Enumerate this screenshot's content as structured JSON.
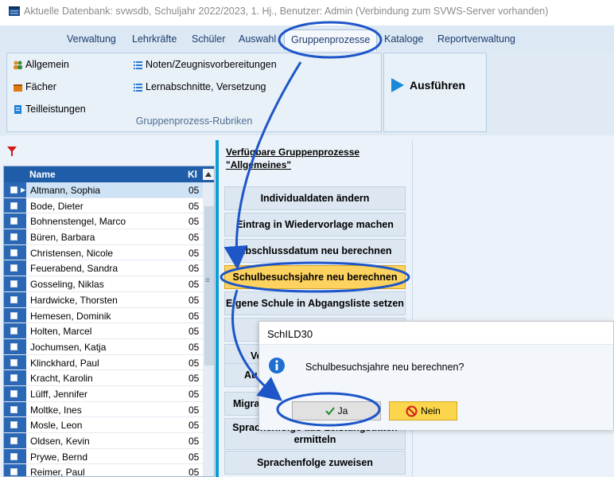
{
  "window": {
    "title": "Aktuelle Datenbank: svwsdb, Schuljahr 2022/2023, 1. Hj., Benutzer: Admin (Verbindung zum SVWS-Server vorhanden)"
  },
  "menu": {
    "tabs": [
      {
        "label": "Verwaltung"
      },
      {
        "label": "Lehrkräfte"
      },
      {
        "label": "Schüler"
      },
      {
        "label": "Auswahl"
      },
      {
        "label": "Gruppenprozesse"
      },
      {
        "label": "Kataloge"
      },
      {
        "label": "Reportverwaltung"
      }
    ],
    "active": "Gruppenprozesse"
  },
  "ribbon": {
    "items": [
      {
        "label": "Allgemein",
        "icon": "people-icon"
      },
      {
        "label": "Fächer",
        "icon": "books-icon"
      },
      {
        "label": "Teilleistungen",
        "icon": "document-icon"
      },
      {
        "label": "Noten/Zeugnisvorbereitungen",
        "icon": "list-icon"
      },
      {
        "label": "Lernabschnitte, Versetzung",
        "icon": "list-icon"
      }
    ],
    "group_label": "Gruppenprozess-Rubriken",
    "run_label": "Ausführen"
  },
  "grid": {
    "columns": [
      "Name",
      "Kl"
    ],
    "rows": [
      {
        "name": "Altmann, Sophia",
        "kl": "05"
      },
      {
        "name": "Bode, Dieter",
        "kl": "05"
      },
      {
        "name": "Bohnenstengel, Marco",
        "kl": "05"
      },
      {
        "name": "Büren, Barbara",
        "kl": "05"
      },
      {
        "name": "Christensen, Nicole",
        "kl": "05"
      },
      {
        "name": "Feuerabend, Sandra",
        "kl": "05"
      },
      {
        "name": "Gosseling, Niklas",
        "kl": "05"
      },
      {
        "name": "Hardwicke, Thorsten",
        "kl": "05"
      },
      {
        "name": "Hemesen, Dominik",
        "kl": "05"
      },
      {
        "name": "Holten, Marcel",
        "kl": "05"
      },
      {
        "name": "Jochumsen, Katja",
        "kl": "05"
      },
      {
        "name": "Klinckhard, Paul",
        "kl": "05"
      },
      {
        "name": "Kracht, Karolin",
        "kl": "05"
      },
      {
        "name": "Lülff, Jennifer",
        "kl": "05"
      },
      {
        "name": "Moltke, Ines",
        "kl": "05"
      },
      {
        "name": "Mosle, Leon",
        "kl": "05"
      },
      {
        "name": "Oldsen, Kevin",
        "kl": "05"
      },
      {
        "name": "Prywe, Bernd",
        "kl": "05"
      },
      {
        "name": "Reimer, Paul",
        "kl": "05"
      }
    ]
  },
  "processes": {
    "heading_line1": "Verfügbare Gruppenprozesse",
    "heading_line2": "\"Allgemeines\"",
    "buttons": [
      {
        "label": "Individualdaten ändern"
      },
      {
        "label": "Eintrag in Wiedervorlage machen"
      },
      {
        "label": "Abschlussdatum neu berechnen"
      },
      {
        "label": "Schulbesuchsjahre neu berechnen"
      },
      {
        "label": "Eigene Schule in Abgangsliste setzen"
      },
      {
        "label": "Ve"
      },
      {
        "label": "Au"
      },
      {
        "label": "Migra"
      },
      {
        "label": "Sprachenfolge aus Leistungsdaten ermitteln"
      },
      {
        "label": "Sprachenfolge zuweisen"
      }
    ]
  },
  "dialog": {
    "title": "SchILD30",
    "message": "Schulbesuchsjahre neu berechnen?",
    "yes_label": "Ja",
    "no_label": "Nein"
  },
  "colors": {
    "accent": "#1f5da8",
    "highlight": "#fdd25e",
    "splitter": "#0a9ed4",
    "annotation": "#1e56c8"
  }
}
